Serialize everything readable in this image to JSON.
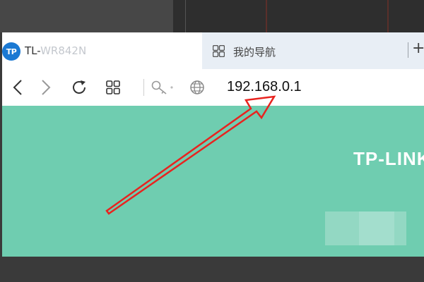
{
  "tabs": [
    {
      "title_visible": "TL-",
      "title_obscured": "WR842N",
      "icon": "tp-link-logo-icon",
      "active": true
    },
    {
      "title": "我的导航",
      "icon": "grid-icon",
      "active": false
    }
  ],
  "new_tab_label": "+",
  "logo_text": "TP",
  "toolbar": {
    "address": "192.168.0.1",
    "icons": [
      "back-icon",
      "forward-icon",
      "reload-icon",
      "grid-icon",
      "key-icon",
      "globe-icon"
    ]
  },
  "page": {
    "brand": "TP-LINK"
  },
  "colors": {
    "page_bg": "#6fcdb0",
    "arrow": "#e8231f",
    "logo_blue": "#1b79d3",
    "tabbar_bg": "#e8eef5"
  }
}
